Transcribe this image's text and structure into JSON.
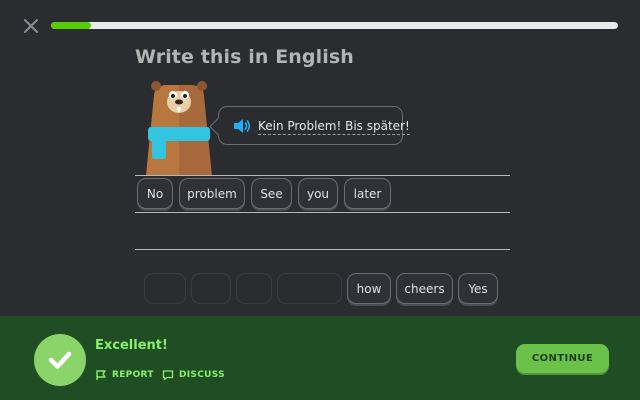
{
  "header": {
    "close_icon": "close-icon",
    "progress_fraction": 0.07,
    "progress_color": "#58cc02"
  },
  "prompt": {
    "title": "Write this in English",
    "sentence": "Kein Problem! Bis später!",
    "speaker_icon": "speaker-icon"
  },
  "answer_tiles": [
    "No",
    "problem",
    "See",
    "you",
    "later"
  ],
  "word_bank": {
    "used_slots": 4,
    "tiles": [
      "how",
      "cheers",
      "Yes"
    ]
  },
  "footer": {
    "status_icon": "check-icon",
    "title": "Excellent!",
    "report_label": "REPORT",
    "discuss_label": "DISCUSS",
    "continue_label": "CONTINUE",
    "colors": {
      "background": "#1f4d24",
      "accent": "#8bef6a",
      "button": "#6ac24a"
    }
  }
}
